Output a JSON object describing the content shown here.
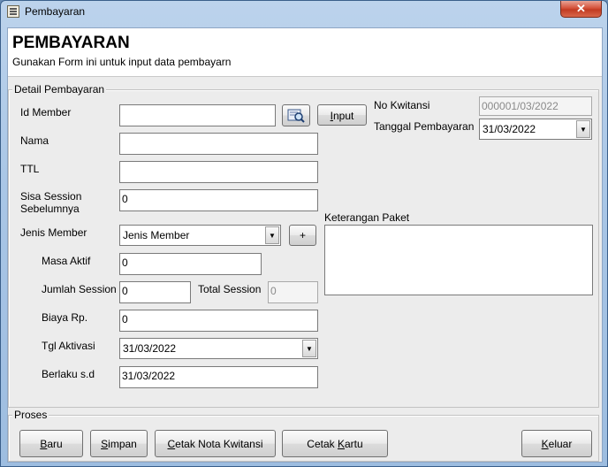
{
  "window": {
    "title": "Pembayaran",
    "close_glyph": "✕"
  },
  "header": {
    "title": "PEMBAYARAN",
    "subtitle": "Gunakan Form ini untuk input data pembayarn"
  },
  "detail_group": {
    "label": "Detail Pembayaran"
  },
  "fields": {
    "id_member": {
      "label": "Id Member",
      "value": ""
    },
    "nama": {
      "label": "Nama",
      "value": ""
    },
    "ttl": {
      "label": "TTL",
      "value": ""
    },
    "sisa_session": {
      "label_line1": "Sisa Session",
      "label_line2": "Sebelumnya",
      "value": "0"
    },
    "jenis_member": {
      "label": "Jenis Member",
      "value": "Jenis Member"
    },
    "masa_aktif": {
      "label": "Masa Aktif",
      "value": "0"
    },
    "jumlah_session": {
      "label": "Jumlah Session",
      "value": "0"
    },
    "total_session": {
      "label": "Total Session",
      "value": "0"
    },
    "biaya": {
      "label": "Biaya Rp.",
      "value": "0"
    },
    "tgl_aktivasi": {
      "label": "Tgl Aktivasi",
      "value": "31/03/2022"
    },
    "berlaku_sd": {
      "label": "Berlaku s.d",
      "value": "31/03/2022"
    },
    "no_kwitansi": {
      "label": "No Kwitansi",
      "value": "000001/03/2022"
    },
    "tanggal_pembayaran": {
      "label": "Tanggal Pembayaran",
      "value": "31/03/2022"
    },
    "keterangan_paket": {
      "label": "Keterangan Paket",
      "value": ""
    }
  },
  "buttons": {
    "input": {
      "mnemonic": "I",
      "rest": "nput"
    },
    "add_jenis": {
      "label": "+"
    },
    "baru": {
      "mnemonic": "B",
      "rest": "aru"
    },
    "simpan": {
      "mnemonic": "S",
      "rest": "impan"
    },
    "cetak_nota": {
      "mnemonic": "C",
      "rest": "etak Nota Kwitansi"
    },
    "cetak_kartu": {
      "pre": "Cetak ",
      "mnemonic": "K",
      "rest": "artu"
    },
    "keluar": {
      "mnemonic": "K",
      "rest": "eluar"
    }
  },
  "proses_group": {
    "label": "Proses"
  },
  "icons": {
    "search": "search-member-icon",
    "dropdown": "▼"
  }
}
